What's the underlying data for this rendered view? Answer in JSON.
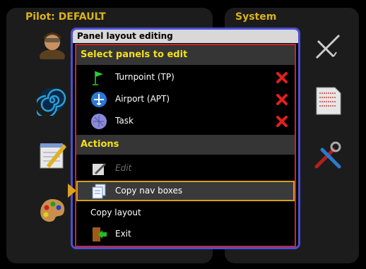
{
  "background": {
    "left_panel_title": "Pilot: DEFAULT",
    "right_panel_title": "System",
    "left_icons": [
      "pilot-avatar-icon",
      "spiral-icon",
      "notepad-icon",
      "palette-icon"
    ],
    "right_icons": [
      "airplane-icon",
      "checklist-document-icon",
      "tools-icon"
    ]
  },
  "dialog": {
    "title": "Panel layout editing",
    "select_section": {
      "header": "Select panels to edit",
      "items": [
        {
          "label": "Turnpoint (TP)",
          "icon": "flag-icon"
        },
        {
          "label": "Airport (APT)",
          "icon": "airport-icon"
        },
        {
          "label": "Task",
          "icon": "task-icon"
        }
      ],
      "delete_icon": "red-x-icon"
    },
    "actions_section": {
      "header": "Actions",
      "items": [
        {
          "label": "Edit",
          "icon": "edit-pencil-icon",
          "disabled": true
        },
        {
          "label": "Copy nav boxes",
          "icon": "copy-documents-icon",
          "selected": true
        },
        {
          "label": "Copy layout"
        },
        {
          "label": "Exit",
          "icon": "exit-door-icon"
        }
      ]
    }
  },
  "colors": {
    "accent_yellow": "#f2e01a",
    "dialog_border": "#4a4fd6",
    "inner_border": "#c8262c",
    "selection_border": "#d4a018",
    "delete_red": "#e02020"
  }
}
